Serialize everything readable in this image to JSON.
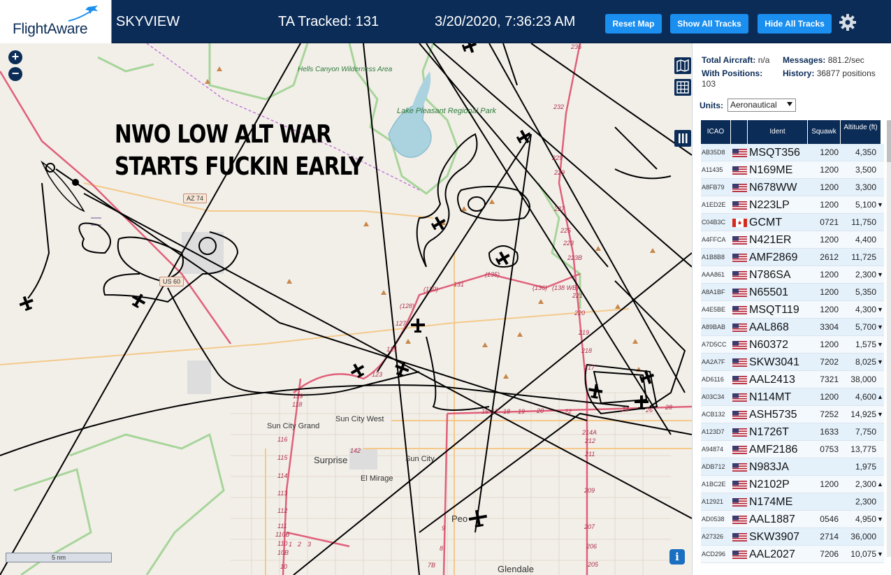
{
  "header": {
    "logo": "FlightAware",
    "app_name": "SKYVIEW",
    "tracked": "TA Tracked: 131",
    "datetime": "3/20/2020, 7:36:23 AM",
    "buttons": {
      "reset": "Reset Map",
      "show_all": "Show All Tracks",
      "hide_all": "Hide All Tracks"
    },
    "settings_icon": "gear-icon"
  },
  "map": {
    "overlay_text_line1": "NWO LOW ALT WAR",
    "overlay_text_line2": "STARTS FUCKIN EARLY",
    "zoom_in": "+",
    "zoom_out": "−",
    "scale": "5 nm",
    "info": "i",
    "labels": {
      "hells_canyon": "Hells Canyon Wilderness Area",
      "lake_pleasant": "Lake Pleasant Regional Park",
      "sun_city_grand": "Sun City Grand",
      "sun_city_west": "Sun City West",
      "surprise": "Surprise",
      "sun_city": "Sun City",
      "el_mirage": "El Mirage",
      "peoria": "Peo",
      "glendale": "Glendale"
    },
    "shields": {
      "az74": "AZ 74",
      "us60": "US 60"
    },
    "road_numbers": [
      "236",
      "232",
      "229",
      "229",
      "227",
      "225",
      "223",
      "223B",
      "(136)",
      "(138 WB)",
      "221",
      "220",
      "219",
      "218",
      "217",
      "(135)",
      "131",
      "(130)",
      "(128)",
      "127",
      "125",
      "123",
      "119",
      "118",
      "116",
      "115",
      "114",
      "113",
      "112",
      "111",
      "110B",
      "110",
      "10B",
      "10",
      "142",
      "214A",
      "212",
      "211",
      "209",
      "207",
      "206",
      "205",
      "28",
      "26",
      "24",
      "22",
      "20",
      "19",
      "18",
      "17",
      "16",
      "1",
      "2",
      "3",
      "9",
      "8",
      "7B"
    ],
    "colors": {
      "header": "#0b2c57",
      "button": "#1a8ff0",
      "track": "#000000",
      "highway": "#e0607a",
      "park": "#a7d59a",
      "water": "#aad3df"
    }
  },
  "panel": {
    "total_aircraft_label": "Total Aircraft:",
    "total_aircraft_value": "n/a",
    "messages_label": "Messages:",
    "messages_value": "881.2/sec",
    "with_positions_label": "With Positions:",
    "with_positions_value": "103",
    "history_label": "History:",
    "history_value": "36877 positions",
    "units_label": "Units:",
    "units_value": "Aeronautical",
    "columns": {
      "icao": "ICAO",
      "ident": "Ident",
      "squawk": "Squawk",
      "altitude": "Altitude (ft)"
    },
    "rows": [
      {
        "icao": "AB35D8",
        "flag": "us",
        "ident": "MSQT356",
        "squawk": "1200",
        "alt": "4,350",
        "trend": ""
      },
      {
        "icao": "A11435",
        "flag": "us",
        "ident": "N169ME",
        "squawk": "1200",
        "alt": "3,500",
        "trend": ""
      },
      {
        "icao": "A8FB79",
        "flag": "us",
        "ident": "N678WW",
        "squawk": "1200",
        "alt": "3,300",
        "trend": ""
      },
      {
        "icao": "A1ED2E",
        "flag": "us",
        "ident": "N223LP",
        "squawk": "1200",
        "alt": "5,100",
        "trend": "▼"
      },
      {
        "icao": "C04B3C",
        "flag": "ca",
        "ident": "GCMT",
        "squawk": "0721",
        "alt": "11,750",
        "trend": ""
      },
      {
        "icao": "A4FFCA",
        "flag": "us",
        "ident": "N421ER",
        "squawk": "1200",
        "alt": "4,400",
        "trend": ""
      },
      {
        "icao": "A1B8B8",
        "flag": "us",
        "ident": "AMF2869",
        "squawk": "2612",
        "alt": "11,725",
        "trend": ""
      },
      {
        "icao": "AAA861",
        "flag": "us",
        "ident": "N786SA",
        "squawk": "1200",
        "alt": "2,300",
        "trend": "▼"
      },
      {
        "icao": "A8A1BF",
        "flag": "us",
        "ident": "N65501",
        "squawk": "1200",
        "alt": "5,350",
        "trend": ""
      },
      {
        "icao": "A4E5BE",
        "flag": "us",
        "ident": "MSQT119",
        "squawk": "1200",
        "alt": "4,300",
        "trend": "▼"
      },
      {
        "icao": "A89BAB",
        "flag": "us",
        "ident": "AAL868",
        "squawk": "3304",
        "alt": "5,700",
        "trend": "▼"
      },
      {
        "icao": "A7D5CC",
        "flag": "us",
        "ident": "N60372",
        "squawk": "1200",
        "alt": "1,575",
        "trend": "▼"
      },
      {
        "icao": "AA2A7F",
        "flag": "us",
        "ident": "SKW3041",
        "squawk": "7202",
        "alt": "8,025",
        "trend": "▼"
      },
      {
        "icao": "AD6116",
        "flag": "us",
        "ident": "AAL2413",
        "squawk": "7321",
        "alt": "38,000",
        "trend": ""
      },
      {
        "icao": "A03C34",
        "flag": "us",
        "ident": "N114MT",
        "squawk": "1200",
        "alt": "4,600",
        "trend": "▲"
      },
      {
        "icao": "ACB132",
        "flag": "us",
        "ident": "ASH5735",
        "squawk": "7252",
        "alt": "14,925",
        "trend": "▼"
      },
      {
        "icao": "A123D7",
        "flag": "us",
        "ident": "N1726T",
        "squawk": "1633",
        "alt": "7,750",
        "trend": ""
      },
      {
        "icao": "A94874",
        "flag": "us",
        "ident": "AMF2186",
        "squawk": "0753",
        "alt": "13,775",
        "trend": ""
      },
      {
        "icao": "ADB712",
        "flag": "us",
        "ident": "N983JA",
        "squawk": "",
        "alt": "1,975",
        "trend": ""
      },
      {
        "icao": "A1BC2E",
        "flag": "us",
        "ident": "N2102P",
        "squawk": "1200",
        "alt": "2,300",
        "trend": "▲"
      },
      {
        "icao": "A12921",
        "flag": "us",
        "ident": "N174ME",
        "squawk": "",
        "alt": "2,300",
        "trend": ""
      },
      {
        "icao": "AD0538",
        "flag": "us",
        "ident": "AAL1887",
        "squawk": "0546",
        "alt": "4,950",
        "trend": "▼"
      },
      {
        "icao": "A27326",
        "flag": "us",
        "ident": "SKW3907",
        "squawk": "2714",
        "alt": "36,000",
        "trend": ""
      },
      {
        "icao": "ACD296",
        "flag": "us",
        "ident": "AAL2027",
        "squawk": "7206",
        "alt": "10,075",
        "trend": "▼"
      }
    ]
  }
}
